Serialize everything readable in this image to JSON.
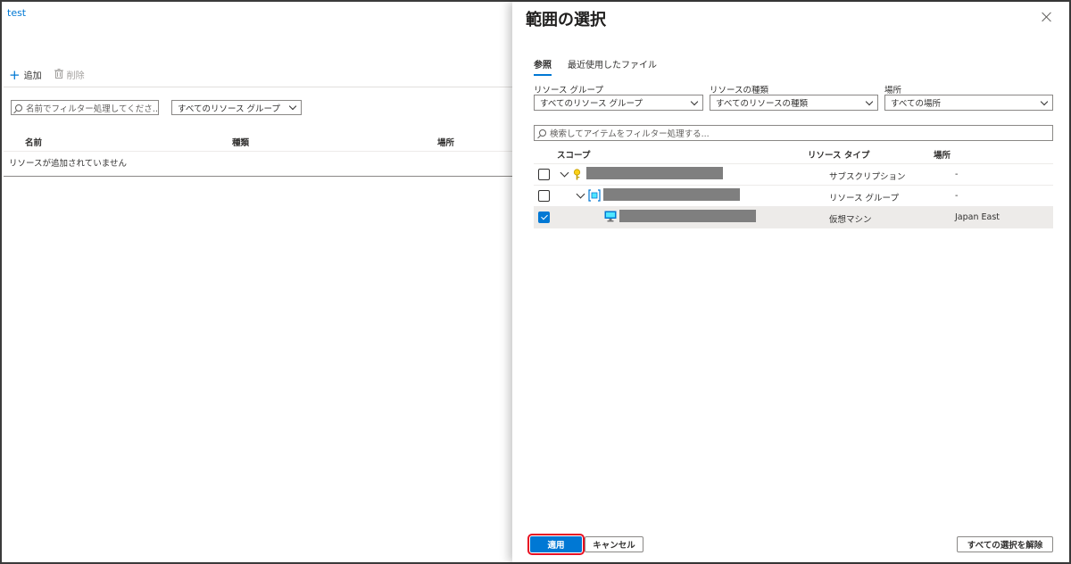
{
  "left": {
    "title": "test",
    "toolbar": {
      "add_label": "追加",
      "delete_label": "削除"
    },
    "filter_placeholder": "名前でフィルター処理してくださ…",
    "rg_select_value": "すべてのリソース グループ",
    "columns": [
      "名前",
      "種類",
      "場所"
    ],
    "empty_message": "リソースが追加されていません"
  },
  "panel": {
    "title": "範囲の選択",
    "tabs": [
      {
        "label": "参照",
        "active": true
      },
      {
        "label": "最近使用したファイル",
        "active": false
      }
    ],
    "filters": [
      {
        "label": "リソース グループ",
        "value": "すべてのリソース グループ"
      },
      {
        "label": "リソースの種類",
        "value": "すべてのリソースの種類"
      },
      {
        "label": "場所",
        "value": "すべての場所"
      }
    ],
    "search_placeholder": "検索してアイテムをフィルター処理する...",
    "table": {
      "headers": [
        "スコープ",
        "リソース タイプ",
        "場所"
      ],
      "rows": [
        {
          "type": "サブスクリプション",
          "location": "-",
          "checked": false,
          "icon": "key-icon",
          "expandable": true
        },
        {
          "type": "リソース グループ",
          "location": "-",
          "checked": false,
          "icon": "resource-group-icon",
          "expandable": true
        },
        {
          "type": "仮想マシン",
          "location": "Japan East",
          "checked": true,
          "icon": "virtual-machine-icon",
          "expandable": false
        }
      ]
    },
    "buttons": {
      "apply": "適用",
      "cancel": "キャンセル",
      "clear_all": "すべての選択を解除"
    }
  },
  "colors": {
    "accent": "#0078d4",
    "highlight": "#e81123",
    "selected_row": "#edebe9"
  }
}
